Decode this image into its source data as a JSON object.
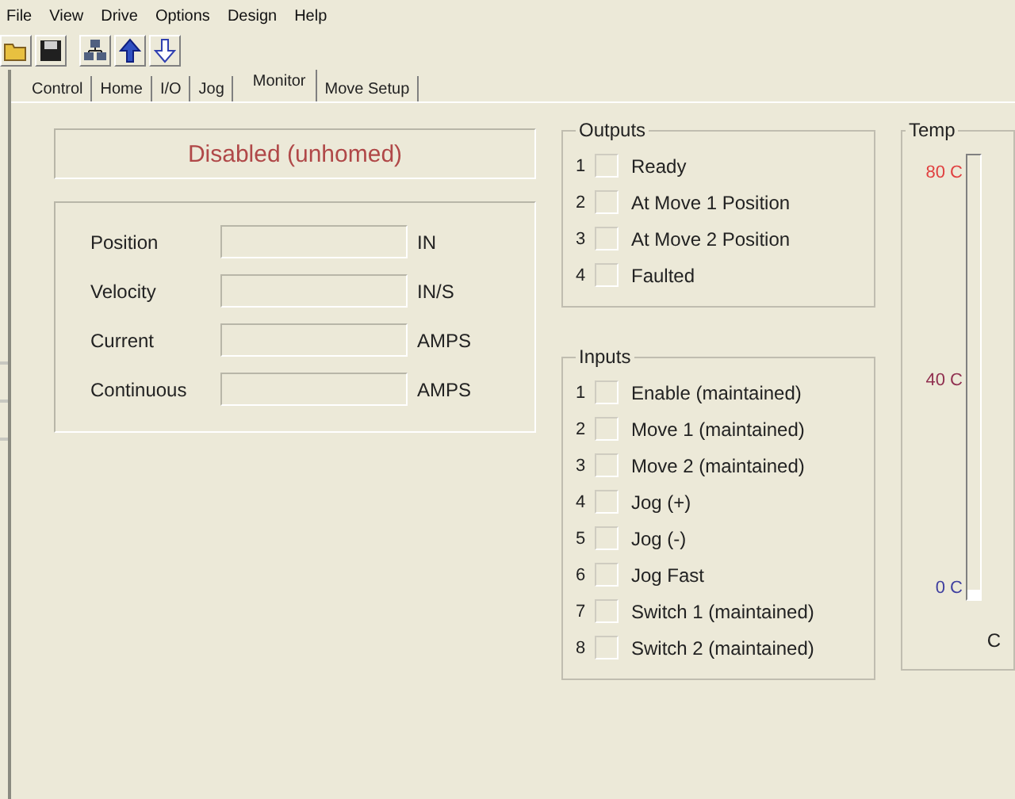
{
  "menu": [
    "File",
    "View",
    "Drive",
    "Options",
    "Design",
    "Help"
  ],
  "toolbar": [
    {
      "kind": "open"
    },
    {
      "kind": "save"
    },
    {
      "kind": "network"
    },
    {
      "kind": "upload"
    },
    {
      "kind": "download"
    }
  ],
  "tabs": [
    {
      "label": "Control",
      "selected": false
    },
    {
      "label": "Home",
      "selected": false
    },
    {
      "label": "I/O",
      "selected": false
    },
    {
      "label": "Jog",
      "selected": false
    },
    {
      "label": "Monitor",
      "selected": true
    },
    {
      "label": "Move Setup",
      "selected": false
    }
  ],
  "status": "Disabled (unhomed)",
  "readings": [
    {
      "label": "Position",
      "unit": "IN"
    },
    {
      "label": "Velocity",
      "unit": "IN/S"
    },
    {
      "label": "Current",
      "unit": "AMPS"
    },
    {
      "label": "Continuous",
      "unit": "AMPS"
    }
  ],
  "outputs": {
    "title": "Outputs",
    "items": [
      {
        "number": "1",
        "label": "Ready",
        "checked": false
      },
      {
        "number": "2",
        "label": "At Move 1 Position",
        "checked": false
      },
      {
        "number": "3",
        "label": "At Move 2 Position",
        "checked": false
      },
      {
        "number": "4",
        "label": "Faulted",
        "checked": false
      }
    ]
  },
  "inputs": {
    "title": "Inputs",
    "items": [
      {
        "number": "1",
        "label": "Enable (maintained)",
        "checked": false
      },
      {
        "number": "2",
        "label": "Move 1 (maintained)",
        "checked": false
      },
      {
        "number": "3",
        "label": "Move 2 (maintained)",
        "checked": false
      },
      {
        "number": "4",
        "label": "Jog (+)",
        "checked": false
      },
      {
        "number": "5",
        "label": "Jog (-)",
        "checked": false
      },
      {
        "number": "6",
        "label": "Jog Fast",
        "checked": false
      },
      {
        "number": "7",
        "label": "Switch 1 (maintained)",
        "checked": false
      },
      {
        "number": "8",
        "label": "Switch 2 (maintained)",
        "checked": false
      }
    ]
  },
  "temp": {
    "title": "Temp",
    "high": "80 C",
    "mid": "40 C",
    "low": "0 C",
    "level": 0.02,
    "unit": "C"
  }
}
